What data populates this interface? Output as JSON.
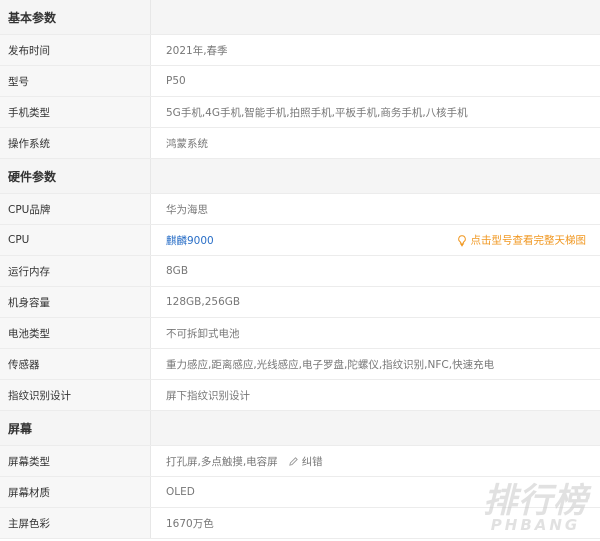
{
  "sections": [
    {
      "title": "基本参数",
      "rows": [
        {
          "label": "发布时间",
          "value": "2021年,春季"
        },
        {
          "label": "型号",
          "value": "P50"
        },
        {
          "label": "手机类型",
          "value": "5G手机,4G手机,智能手机,拍照手机,平板手机,商务手机,八核手机"
        },
        {
          "label": "操作系统",
          "value": "鸿蒙系统"
        }
      ]
    },
    {
      "title": "硬件参数",
      "rows": [
        {
          "label": "CPU品牌",
          "value": "华为海思"
        },
        {
          "label": "CPU",
          "value": "麒麟9000",
          "hint": "点击型号查看完整天梯图"
        },
        {
          "label": "运行内存",
          "value": "8GB"
        },
        {
          "label": "机身容量",
          "value": "128GB,256GB"
        },
        {
          "label": "电池类型",
          "value": "不可拆卸式电池"
        },
        {
          "label": "传感器",
          "value": "重力感应,距离感应,光线感应,电子罗盘,陀螺仪,指纹识别,NFC,快速充电"
        },
        {
          "label": "指纹识别设计",
          "value": "屏下指纹识别设计"
        }
      ]
    },
    {
      "title": "屏幕",
      "rows": [
        {
          "label": "屏幕类型",
          "value": "打孔屏,多点触摸,电容屏",
          "action": "纠错"
        },
        {
          "label": "屏幕材质",
          "value": "OLED"
        },
        {
          "label": "主屏色彩",
          "value": "1670万色"
        }
      ]
    }
  ],
  "watermark": {
    "cn": "排行榜",
    "en": "PHBANG"
  },
  "colors": {
    "link": "#2a6fc7",
    "hint": "#f0961e"
  },
  "icons": {
    "hint": "lightbulb-icon",
    "action": "pencil-icon"
  }
}
